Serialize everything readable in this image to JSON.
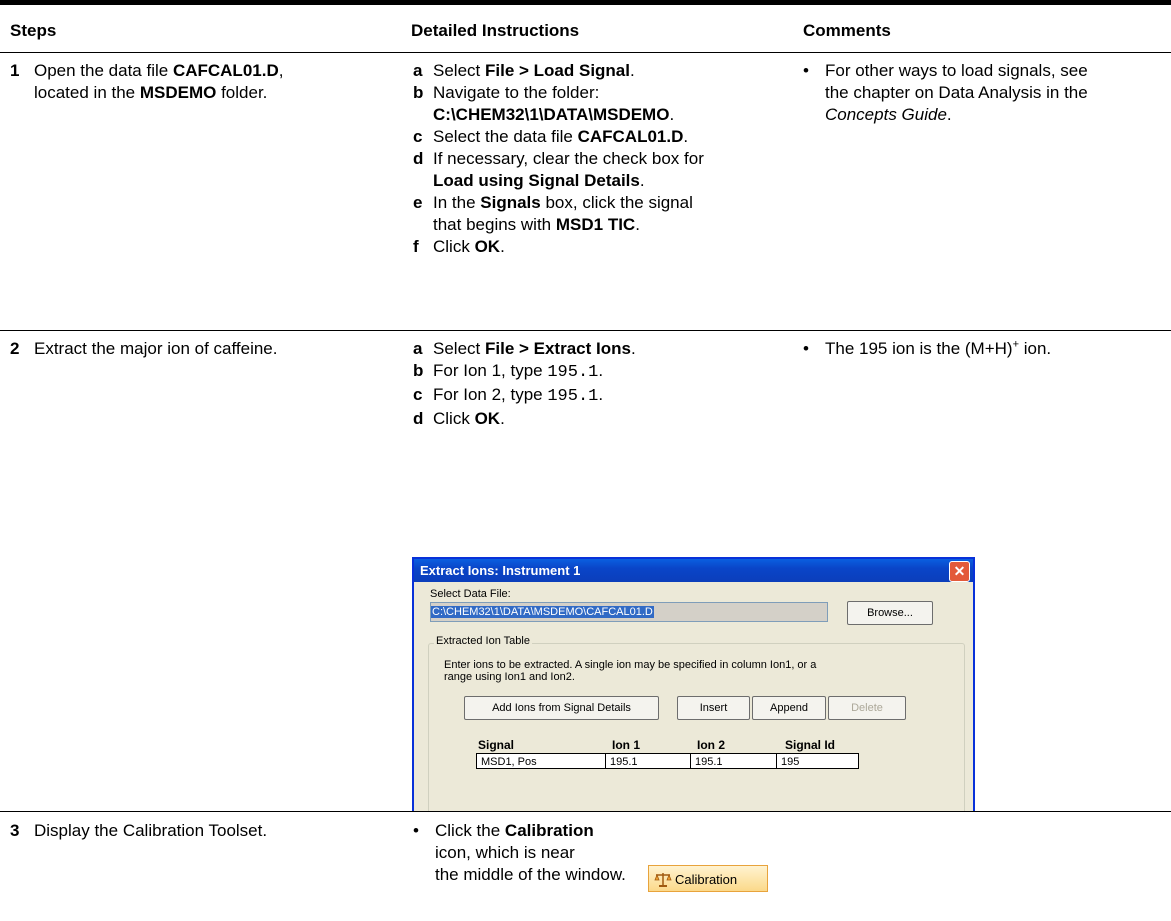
{
  "headers": {
    "steps": "Steps",
    "instructions": "Detailed Instructions",
    "comments": "Comments"
  },
  "step1": {
    "number": "1",
    "text_a": "Open the data file ",
    "text_file": "CAFCAL01.D",
    "text_b": ",",
    "line2_a": "located in the ",
    "line2_folder": "MSDEMO",
    "line2_b": " folder.",
    "instructions": {
      "a": {
        "letter": "a",
        "pre": "Select ",
        "bold": "File > Load Signal",
        "post": "."
      },
      "b": {
        "letter": "b",
        "pre": "Navigate to the folder:",
        "bold": "C:\\CHEM32\\1\\DATA\\MSDEMO",
        "post": "."
      },
      "c": {
        "letter": "c",
        "pre": "Select the data file ",
        "bold": "CAFCAL01.D",
        "post": "."
      },
      "d": {
        "letter": "d",
        "pre": "If necessary, clear the check box for",
        "bold": "Load using Signal Details",
        "post": "."
      },
      "e": {
        "letter": "e",
        "pre": "In the ",
        "bold": "Signals",
        "mid": " box, click the signal",
        "line2": "that begins with ",
        "bold2": "MSD1 TIC",
        "post": "."
      },
      "f": {
        "letter": "f",
        "pre": "Click ",
        "bold": "OK",
        "post": "."
      }
    },
    "comment": {
      "bullet": "•",
      "line1": "For other ways to load signals, see",
      "line2": "the chapter on Data Analysis in the",
      "italic": "Concepts Guide",
      "post": "."
    }
  },
  "step2": {
    "number": "2",
    "text": "Extract the major ion of caffeine.",
    "instructions": {
      "a": {
        "letter": "a",
        "pre": "Select ",
        "bold": "File > Extract Ions",
        "post": "."
      },
      "b": {
        "letter": "b",
        "pre": "For Ion 1, type ",
        "mono": "195.1",
        "post": "."
      },
      "c": {
        "letter": "c",
        "pre": "For Ion 2, type ",
        "mono": "195.1",
        "post": "."
      },
      "d": {
        "letter": "d",
        "pre": "Click ",
        "bold": "OK",
        "post": "."
      }
    },
    "comment": {
      "bullet": "•",
      "pre": "The 195 ion is the (M+H)",
      "sup": "+",
      "post": " ion."
    }
  },
  "dialog": {
    "title": "Extract Ions:  Instrument 1",
    "close_glyph": "✕",
    "select_label": "Select Data File:",
    "file_value": "C:\\CHEM32\\1\\DATA\\MSDEMO\\CAFCAL01.D",
    "browse": "Browse...",
    "group_label": "Extracted Ion Table",
    "help_line1": "Enter ions to be extracted.  A single ion may be specified in column Ion1, or a",
    "help_line2": "range using Ion1 and Ion2.",
    "add_ions": "Add Ions from Signal Details",
    "insert": "Insert",
    "append": "Append",
    "delete": "Delete",
    "columns": [
      "Signal",
      "Ion 1",
      "Ion 2",
      "Signal Id"
    ],
    "row": [
      "MSD1, Pos",
      "195.1",
      "195.1",
      "195"
    ]
  },
  "step3": {
    "number": "3",
    "text": "Display the Calibration Toolset.",
    "bullet": "•",
    "line1_pre": "Click the ",
    "line1_bold": "Calibration",
    "line2": "icon, which is near",
    "line3": "the middle of the window.",
    "button_label": "Calibration",
    "button_icon": "balance-scale-icon"
  }
}
